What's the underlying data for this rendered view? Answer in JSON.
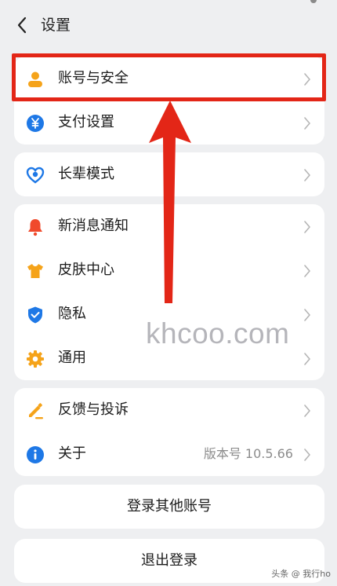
{
  "header": {
    "title": "设置"
  },
  "groups": {
    "account": {
      "items": [
        {
          "label": "账号与安全",
          "icon": "person-icon"
        },
        {
          "label": "支付设置",
          "icon": "yuan-icon"
        }
      ]
    },
    "elder": {
      "items": [
        {
          "label": "长辈模式",
          "icon": "heart-care-icon"
        }
      ]
    },
    "general": {
      "items": [
        {
          "label": "新消息通知",
          "icon": "bell-icon"
        },
        {
          "label": "皮肤中心",
          "icon": "tshirt-icon"
        },
        {
          "label": "隐私",
          "icon": "shield-check-icon"
        },
        {
          "label": "通用",
          "icon": "gear-icon"
        }
      ]
    },
    "support": {
      "items": [
        {
          "label": "反馈与投诉",
          "icon": "pencil-icon"
        },
        {
          "label": "关于",
          "icon": "info-icon",
          "value": "版本号 10.5.66"
        }
      ]
    }
  },
  "buttons": {
    "switch_account": "登录其他账号",
    "logout": "退出登录"
  },
  "overlay": {
    "watermark": "khcoo.com",
    "credit": "头条 @ 我行ho"
  },
  "colors": {
    "highlight": "#e32617",
    "person": "#f5a31a",
    "pay": "#1e78e6",
    "elder": "#1e78e6",
    "bell": "#f04a2c",
    "tshirt": "#f5a31a",
    "privacy": "#1e78e6",
    "gear": "#f5a31a",
    "pencil": "#f5a31a",
    "info": "#1e78e6"
  }
}
